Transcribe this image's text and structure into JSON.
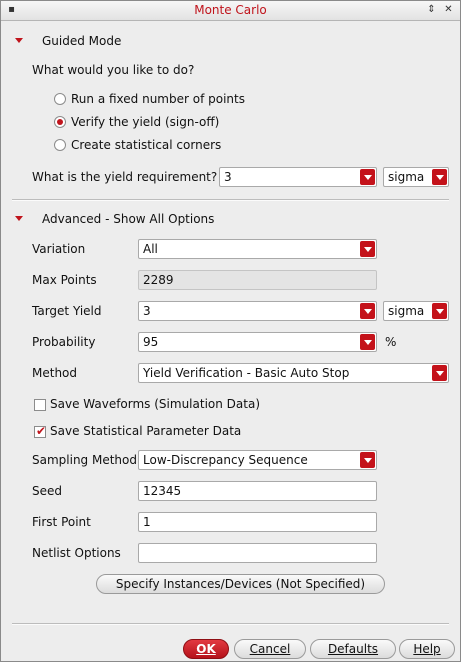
{
  "window": {
    "title": "Monte Carlo"
  },
  "guided": {
    "header": "Guided Mode",
    "question": "What would you like to do?",
    "options": [
      {
        "label": "Run a fixed number of points",
        "selected": false
      },
      {
        "label": "Verify the yield (sign-off)",
        "selected": true
      },
      {
        "label": "Create statistical corners",
        "selected": false
      }
    ],
    "yield_label": "What is the yield requirement?",
    "yield_value": "3",
    "yield_unit": "sigma"
  },
  "advanced": {
    "header": "Advanced - Show All Options",
    "variation": {
      "label": "Variation",
      "value": "All"
    },
    "max_points": {
      "label": "Max Points",
      "value": "2289"
    },
    "target_yield": {
      "label": "Target Yield",
      "value": "3",
      "unit": "sigma"
    },
    "probability": {
      "label": "Probability",
      "value": "95",
      "unit": "%"
    },
    "method": {
      "label": "Method",
      "value": "Yield Verification - Basic Auto Stop"
    },
    "save_waveforms": {
      "label": "Save Waveforms (Simulation Data)",
      "checked": false
    },
    "save_statistical": {
      "label": "Save Statistical Parameter Data",
      "checked": true
    },
    "sampling": {
      "label": "Sampling Method",
      "value": "Low-Discrepancy Sequence"
    },
    "seed": {
      "label": "Seed",
      "value": "12345"
    },
    "first_point": {
      "label": "First Point",
      "value": "1"
    },
    "netlist": {
      "label": "Netlist Options",
      "value": ""
    },
    "specify_button": "Specify Instances/Devices (Not Specified)"
  },
  "buttons": {
    "ok": "OK",
    "cancel": "Cancel",
    "defaults": "Defaults",
    "help": "Help"
  },
  "accent_color": "#c0141c"
}
